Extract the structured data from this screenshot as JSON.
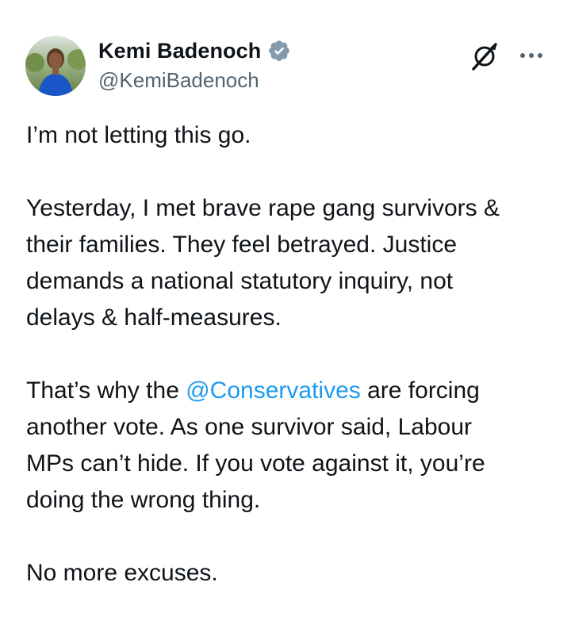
{
  "author": {
    "display_name": "Kemi Badenoch",
    "handle": "@KemiBadenoch",
    "verified_icon": "verified-badge-icon",
    "verified_color": "#829aab"
  },
  "actions": {
    "grok_icon": "grok-icon",
    "more_icon": "more-options-icon"
  },
  "tweet": {
    "p1": "I’m not letting this go.",
    "p2_lines": [
      "Yesterday, I met brave rape gang survivors &",
      "their families. They feel betrayed. Justice",
      "demands a national statutory inquiry, not",
      "delays & half-measures."
    ],
    "p3_line1_before": "That’s why the ",
    "p3_mention": "@Conservatives",
    "p3_line1_after": " are forcing",
    "p3_lines_rest": [
      "another vote. As one survivor said, Labour",
      "MPs can’t hide. If you vote against it, you’re",
      "doing the wrong thing."
    ],
    "p4": "No more excuses."
  },
  "colors": {
    "text": "#0f1419",
    "secondary": "#536471",
    "link": "#1d9bf0"
  }
}
